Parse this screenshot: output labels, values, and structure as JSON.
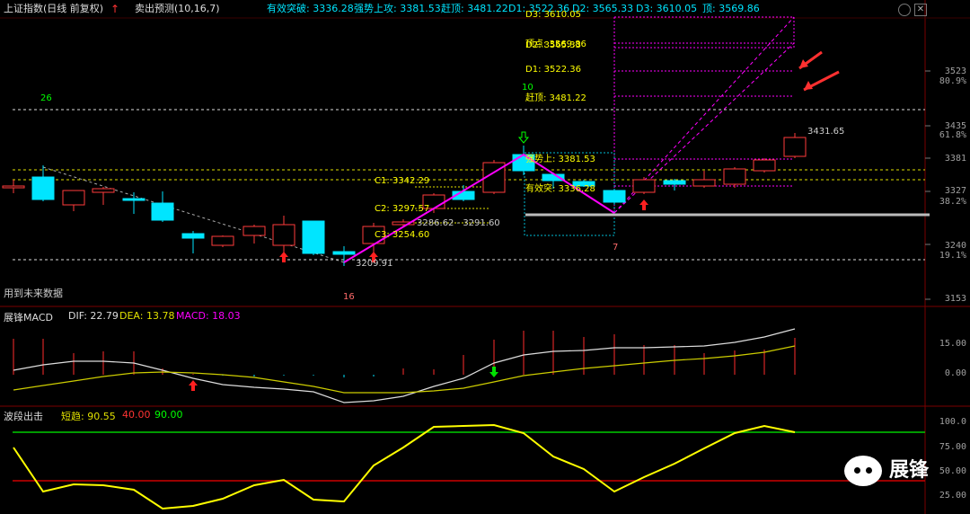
{
  "header": {
    "index_title": "上证指数(日线 前复权)",
    "indicator_title": "卖出预测(10,16,7)",
    "valid_break": "有效突破: 3336.28",
    "strong_up": "强势上攻: 3381.53",
    "catch_top": "赶顶: 3481.22",
    "d1": "D1: 3522.36",
    "d2": "D2: 3565.33",
    "d3": "D3: 3610.05",
    "top": "顶: 3569.86"
  },
  "main_panel": {
    "note_future": "用到未来数据",
    "label_26": "26",
    "label_10": "10",
    "label_7": "7",
    "label_16": "16",
    "level_labels": {
      "d3": "D3: 3610.05",
      "top": "顶点: 3569.86",
      "d2": "D2: 3565.33",
      "d1": "D1: 3522.36",
      "catch_top": "赶顶: 3481.22",
      "strong_up": "强势上: 3381.53",
      "valid": "有效突: 3336.28",
      "c1": "C1: 3342.29",
      "c2": "C2: 3297.57",
      "c3": "C3: 3254.60",
      "gap": "3286.62 - 3291.60",
      "low": "3209.91",
      "high": "3431.65"
    },
    "y_ticks": [
      "3523",
      "80.9%",
      "3435",
      "61.8%",
      "3381",
      "3327",
      "38.2%",
      "3240",
      "19.1%",
      "3153"
    ],
    "colors": {
      "up": "#ff3b3b",
      "down": "#00e5ff",
      "zigzag": "#ff00ff",
      "dash_yellow": "#e0e000",
      "label_yellow": "#ffff00"
    }
  },
  "macd_panel": {
    "name": "展锋MACD",
    "dif": "DIF: 22.79",
    "dea": "DEA: 13.78",
    "macd": "MACD: 18.03",
    "y_ticks": [
      "15.00",
      "0.00"
    ]
  },
  "wave_panel": {
    "name": "波段出击",
    "short": "短趋: 90.55",
    "v40": "40.00",
    "v90": "90.00",
    "y_ticks": [
      "100.0",
      "75.00",
      "50.00",
      "25.00"
    ]
  },
  "watermark": {
    "text": "展锋"
  },
  "icons": [
    "gear-icon",
    "close-icon",
    "arrow-up-icon",
    "arrow-down-icon"
  ]
}
